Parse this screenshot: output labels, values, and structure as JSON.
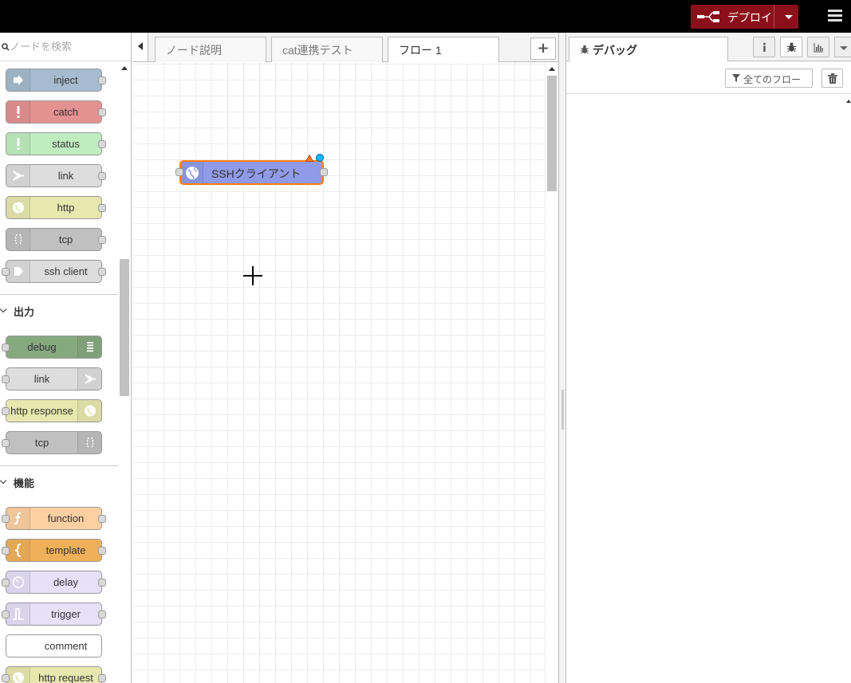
{
  "header": {
    "deploy_label": "デプロイ"
  },
  "palette": {
    "search_placeholder": "ノードを検索",
    "input_nodes": [
      {
        "label": "inject",
        "color": "#a6bbcf"
      },
      {
        "label": "catch",
        "color": "#e49191"
      },
      {
        "label": "status",
        "color": "#c0edc0"
      },
      {
        "label": "link",
        "color": "#dddddd"
      },
      {
        "label": "http",
        "color": "#e7e7ae"
      },
      {
        "label": "tcp",
        "color": "#c0c0c0"
      },
      {
        "label": "ssh client",
        "color": "#dddddd"
      }
    ],
    "categories": {
      "output": "出力",
      "function": "機能"
    },
    "output_nodes": [
      {
        "label": "debug",
        "color": "#87a980"
      },
      {
        "label": "link",
        "color": "#dddddd"
      },
      {
        "label": "http response",
        "color": "#e7e7ae"
      },
      {
        "label": "tcp",
        "color": "#c0c0c0"
      }
    ],
    "function_nodes": [
      {
        "label": "function",
        "color": "#fdd0a2"
      },
      {
        "label": "template",
        "color": "#f0b05a"
      },
      {
        "label": "delay",
        "color": "#e6e0f8"
      },
      {
        "label": "trigger",
        "color": "#e6e0f8"
      },
      {
        "label": "comment",
        "color": "#ffffff"
      },
      {
        "label": "http request",
        "color": "#e7e7ae"
      }
    ]
  },
  "workspace": {
    "tabs": [
      {
        "label": "ノード説明"
      },
      {
        "label": "cat連携テスト"
      },
      {
        "label": "フロー 1"
      }
    ],
    "active_tab": "フロー 1",
    "nodes": [
      {
        "label": "SSHクライアント",
        "color": "#8f9be8",
        "status": "changed-with-warning"
      }
    ]
  },
  "sidebar": {
    "active_tab_label": "デバッグ",
    "filter_label": "全てのフロー",
    "buttons": [
      "info-icon",
      "bug-icon",
      "chart-icon"
    ]
  }
}
